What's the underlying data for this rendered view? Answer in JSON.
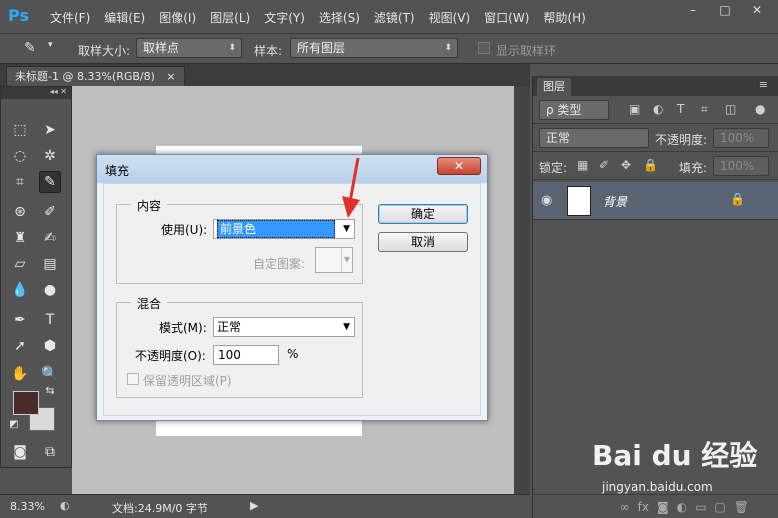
{
  "app": {
    "logo": "Ps",
    "menu": [
      "文件(F)",
      "编辑(E)",
      "图像(I)",
      "图层(L)",
      "文字(Y)",
      "选择(S)",
      "滤镜(T)",
      "视图(V)",
      "窗口(W)",
      "帮助(H)"
    ],
    "window_controls": [
      "–",
      "□",
      "✕"
    ]
  },
  "options_bar": {
    "sample_size_label": "取样大小:",
    "sample_size_value": "取样点",
    "sample_label": "样本:",
    "sample_value": "所有图层",
    "show_ring_label": "显示取样环"
  },
  "document": {
    "tab_label": "未标题-1 @ 8.33%(RGB/8)",
    "tab_close": "×"
  },
  "status": {
    "zoom": "8.33%",
    "info": "文档:24.9M/0 字节"
  },
  "layers_panel": {
    "tab": "图层",
    "filter_label": "ρ 类型",
    "blend_mode": "正常",
    "opacity_label": "不透明度:",
    "opacity_value": "100%",
    "lock_label": "锁定:",
    "fill_label": "填充:",
    "fill_value": "100%",
    "layer_name": "背景"
  },
  "dialog": {
    "title": "填充",
    "close_label": "✕",
    "contents_group": "内容",
    "use_label": "使用(U):",
    "use_value": "前景色",
    "custom_pattern_label": "自定图案:",
    "blending_group": "混合",
    "mode_label": "模式(M):",
    "mode_value": "正常",
    "opacity_label": "不透明度(O):",
    "opacity_value": "100",
    "opacity_unit": "%",
    "preserve_label": "保留透明区域(P)",
    "ok_label": "确定",
    "cancel_label": "取消"
  },
  "watermark": {
    "logo": "Bai du 经验",
    "url": "jingyan.baidu.com"
  },
  "colors": {
    "foreground": "#4a2b2b",
    "background": "#d9d9d9",
    "accent": "#31a8ff",
    "annotation": "#e0302a"
  }
}
